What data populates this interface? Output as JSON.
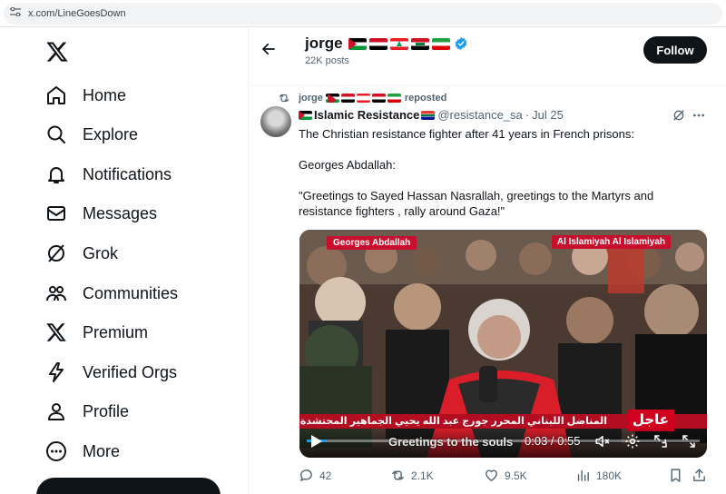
{
  "browser": {
    "url": "x.com/LineGoesDown"
  },
  "sidebar": {
    "items": [
      {
        "label": "Home",
        "icon": "home-icon"
      },
      {
        "label": "Explore",
        "icon": "search-icon"
      },
      {
        "label": "Notifications",
        "icon": "bell-icon"
      },
      {
        "label": "Messages",
        "icon": "envelope-icon"
      },
      {
        "label": "Grok",
        "icon": "grok-icon"
      },
      {
        "label": "Communities",
        "icon": "people-icon"
      },
      {
        "label": "Premium",
        "icon": "x-logo-icon"
      },
      {
        "label": "Verified Orgs",
        "icon": "lightning-icon"
      },
      {
        "label": "Profile",
        "icon": "person-icon"
      },
      {
        "label": "More",
        "icon": "more-circle-icon"
      }
    ]
  },
  "header": {
    "name": "jorge",
    "posts_count": "22K posts",
    "follow_label": "Follow"
  },
  "repost": {
    "name": "jorge",
    "suffix": "reposted"
  },
  "tweet": {
    "display_name": "Islamic Resistance",
    "handle": "@resistance_sa",
    "separator": "·",
    "date": "Jul 25",
    "lines": [
      "The Christian resistance fighter after 41 years in French prisons:",
      "Georges Abdallah:",
      "\"Greetings to Sayed Hassan Nasrallah, greetings to the Martyrs and resistance fighters , rally around Gaza!\""
    ],
    "video": {
      "tag_left": "Georges Abdallah",
      "tag_right": "Al Islamiyah Al Islamiyah",
      "arabic_caption": "المناضل اللبناني المحرر جورج عبد الله يحيي الجماهير المحتشدة",
      "breaking": "عاجل",
      "subtitle": "Greetings to the souls",
      "time": "0:03 / 0:55",
      "progress": 0.05
    },
    "stats": {
      "replies": "42",
      "reposts": "2.1K",
      "likes": "9.5K",
      "views": "180K"
    }
  },
  "colors": {
    "accent": "#1d9bf0",
    "text": "#0f1419",
    "muted": "#536471",
    "breaking_red": "#c8102e"
  }
}
